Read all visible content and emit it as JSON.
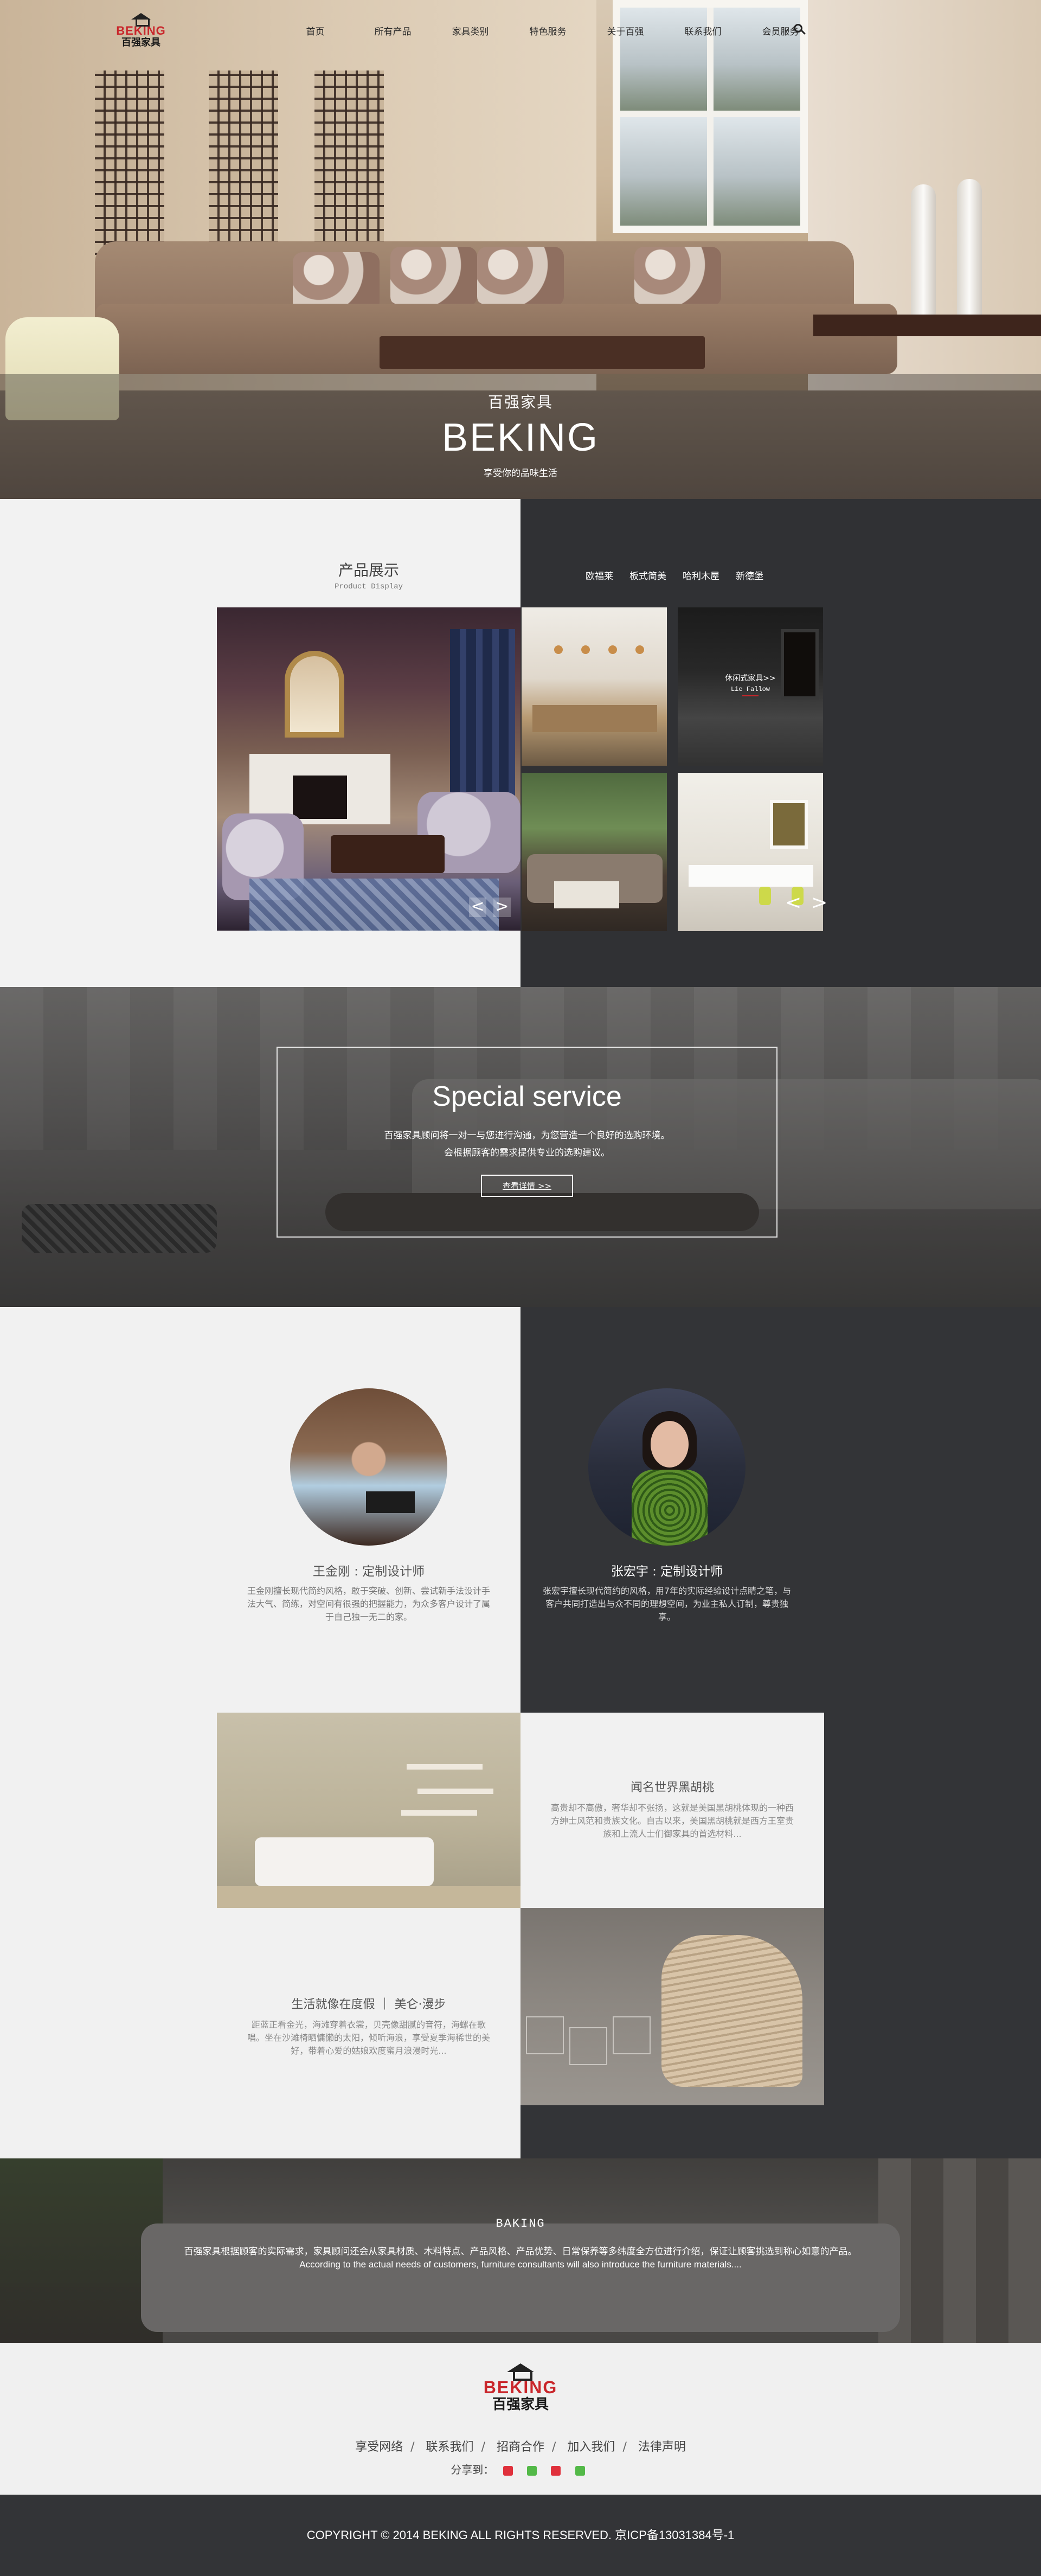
{
  "nav": {
    "logo_en": "BEKING",
    "logo_zh": "百强家具",
    "menu": [
      "首页",
      "所有产品",
      "家具类别",
      "特色服务",
      "关于百强",
      "联系我们",
      "会员服务"
    ],
    "search_icon": "search-icon"
  },
  "hero": {
    "sub": "百强家具",
    "brand": "BEKING",
    "slogan": "享受你的品味生活"
  },
  "products": {
    "title_zh": "产品展示",
    "title_en": "Product Display",
    "tags": [
      "欧福莱",
      "板式简美",
      "哈利木屋",
      "新德堡"
    ],
    "featured_caption_zh": "休闲式家具>>",
    "featured_caption_en": "Lie Fallow",
    "prev_label": "<",
    "next_label": ">"
  },
  "service": {
    "title": "Special service",
    "line1": "百强家具顾问将一对一与您进行沟通，为您营造一个良好的选购环境。",
    "line2": "会根据顾客的需求提供专业的选购建议。",
    "button": "查看详情 >>"
  },
  "designers": [
    {
      "name": "王金刚 : 定制设计师",
      "bio": "王金刚擅长现代简约风格，敢于突破、创新、尝试新手法设计手法大气、简练，对空间有很强的把握能力，为众多客户设计了属于自己独一无二的家。"
    },
    {
      "name": "张宏宇 : 定制设计师",
      "bio": "张宏宇擅长现代简约的风格，用7年的实际经验设计点睛之笔，与客户共同打造出与众不同的理想空间，为业主私人订制，尊贵独享。"
    }
  ],
  "features": [
    {
      "title": "闻名世界黑胡桃",
      "text": "高贵却不高傲，奢华却不张扬，这就是美国黑胡桃体现的一种西方绅士风范和贵族文化。自古以来，美国黑胡桃就是西方王室贵族和上流人士们御家具的首选材料..."
    },
    {
      "title": "生活就像在度假 ｜ 美仑·漫步",
      "text": "距蓝正看金光，海滩穿着衣裳，贝壳像甜腻的音符，海螺在歌唱。坐在沙滩椅晒慵懒的太阳，倾听海浪，享受夏季海稀世的美好，带着心爱的姑娘欢度蜜月浪漫时光..."
    }
  ],
  "about": {
    "title": "BAKING",
    "zh": "百强家具根据顾客的实际需求，家具顾问还会从家具材质、木料特点、产品风格、产品优势、日常保养等多纬度全方位进行介绍，保证让顾客挑选到称心如意的产品。",
    "en": "According to the actual needs of customers, furniture consultants will also introduce the furniture materials...."
  },
  "footer": {
    "logo_en": "BEKING",
    "logo_zh": "百强家具",
    "links": [
      "享受网络",
      "联系我们",
      "招商合作",
      "加入我们",
      "法律声明"
    ],
    "share_label": "分享到：",
    "share_icons": [
      "weibo-icon",
      "wechat-icon",
      "qzone-icon",
      "friends-icon"
    ],
    "share_colors": [
      "#e0313c",
      "#53b948",
      "#e0313c",
      "#53b948"
    ],
    "copyright": "COPYRIGHT © 2014 BEKING ALL RIGHTS RESERVED. 京ICP备13031384号-1"
  }
}
